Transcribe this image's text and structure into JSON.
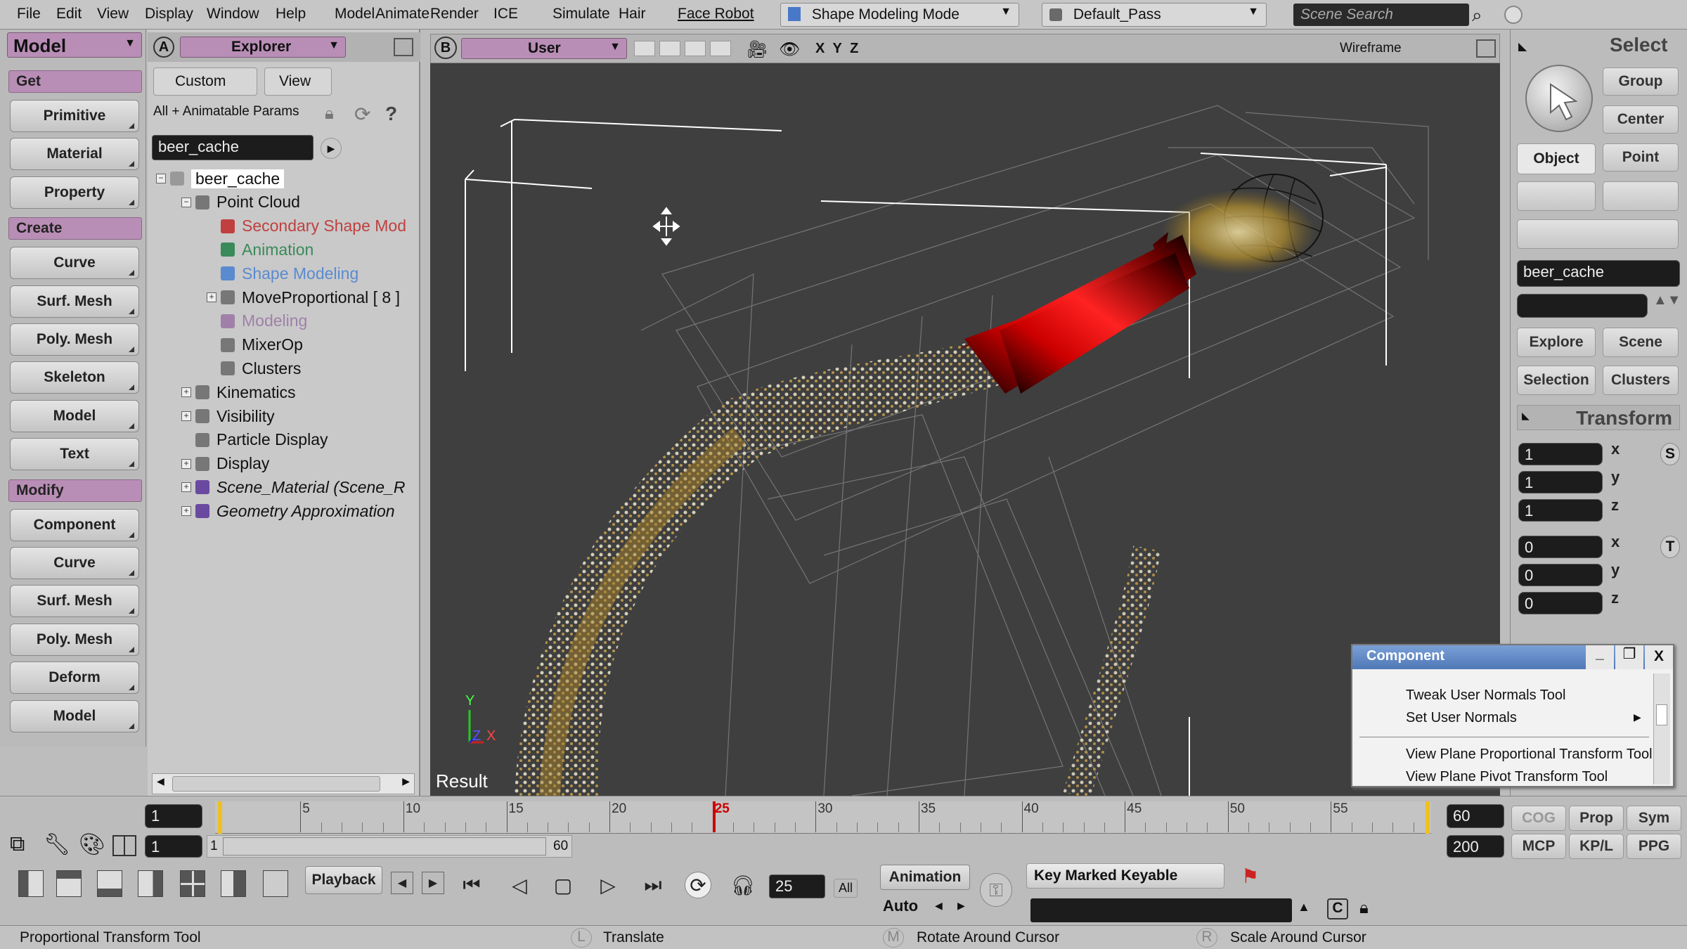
{
  "menu": [
    "File",
    "Edit",
    "View",
    "Display",
    "Window",
    "Help",
    "Model",
    "Animate",
    "Render",
    "ICE",
    "Simulate",
    "Hair",
    "Face Robot"
  ],
  "mode_dropdown": "Shape Modeling Mode",
  "pass_dropdown": "Default_Pass",
  "scene_search_placeholder": "Scene Search",
  "left_panel": {
    "title": "Model",
    "sections": [
      {
        "label": "Get",
        "buttons": [
          "Primitive",
          "Material",
          "Property"
        ]
      },
      {
        "label": "Create",
        "buttons": [
          "Curve",
          "Surf. Mesh",
          "Poly. Mesh",
          "Skeleton",
          "Model",
          "Text"
        ]
      },
      {
        "label": "Modify",
        "buttons": [
          "Component",
          "Curve",
          "Surf. Mesh",
          "Poly. Mesh",
          "Deform",
          "Model"
        ]
      }
    ]
  },
  "explorer": {
    "letter": "A",
    "title": "Explorer",
    "tab_custom": "Custom",
    "tab_view": "View",
    "filter": "All + Animatable Params",
    "search_value": "beer_cache",
    "tree": [
      {
        "label": "beer_cache",
        "indent": 0,
        "toggle": "−",
        "style": "selected"
      },
      {
        "label": "Point Cloud",
        "indent": 1,
        "toggle": "−",
        "style": "normal"
      },
      {
        "label": "Secondary Shape Mod",
        "indent": 2,
        "toggle": "",
        "style": "red"
      },
      {
        "label": "Animation",
        "indent": 2,
        "toggle": "",
        "style": "green"
      },
      {
        "label": "Shape Modeling",
        "indent": 2,
        "toggle": "",
        "style": "blue"
      },
      {
        "label": "MoveProportional [ 8 ]",
        "indent": 2,
        "toggle": "+",
        "style": "normal"
      },
      {
        "label": "Modeling",
        "indent": 2,
        "toggle": "",
        "style": "purple"
      },
      {
        "label": "MixerOp",
        "indent": 2,
        "toggle": "",
        "style": "normal"
      },
      {
        "label": "Clusters",
        "indent": 2,
        "toggle": "",
        "style": "normal"
      },
      {
        "label": "Kinematics",
        "indent": 1,
        "toggle": "+",
        "style": "normal"
      },
      {
        "label": "Visibility",
        "indent": 1,
        "toggle": "+",
        "style": "normal"
      },
      {
        "label": "Particle Display",
        "indent": 1,
        "toggle": "",
        "style": "normal"
      },
      {
        "label": "Display",
        "indent": 1,
        "toggle": "+",
        "style": "normal"
      },
      {
        "label": "Scene_Material (Scene_R",
        "indent": 1,
        "toggle": "+",
        "style": "italic"
      },
      {
        "label": "Geometry Approximation",
        "indent": 1,
        "toggle": "+",
        "style": "italic"
      }
    ]
  },
  "viewport": {
    "letter": "B",
    "camera": "User",
    "axes": "X Y Z",
    "display_mode": "Wireframe",
    "result_label": "Result",
    "gizmo": {
      "y": "Y",
      "z": "Z",
      "x": "X"
    }
  },
  "right_panel": {
    "title": "Select",
    "buttons_top": [
      "Group",
      "Center",
      "Object",
      "Point"
    ],
    "name_field": "beer_cache",
    "buttons_mid": [
      "Explore",
      "Scene",
      "Selection",
      "Clusters"
    ],
    "transform_title": "Transform",
    "scale": [
      "1",
      "1",
      "1"
    ],
    "translate": [
      "0",
      "0",
      "0"
    ],
    "axes": [
      "x",
      "y",
      "z"
    ],
    "scale_letter": "S",
    "translate_letter": "T"
  },
  "component_popup": {
    "title": "Component",
    "items": [
      "Tweak User Normals Tool",
      "Set User Normals",
      "View Plane Proportional Transform Tool",
      "View Plane Pivot Transform Tool"
    ]
  },
  "timeline": {
    "start": "1",
    "end": "60",
    "current_frame": 25,
    "ticks": [
      "5",
      "10",
      "15",
      "20",
      "25",
      "30",
      "35",
      "40",
      "45",
      "50",
      "55"
    ],
    "range_start": "1",
    "range_start2": "1",
    "range_end": "60",
    "range_max": "200"
  },
  "playback": {
    "label": "Playback",
    "frame": "25",
    "all": "All",
    "animation": "Animation",
    "auto": "Auto",
    "key_label": "Key Marked Keyable"
  },
  "bottom_right": [
    "COG",
    "Prop",
    "Sym",
    "MCP",
    "KP/L",
    "PPG"
  ],
  "status": {
    "tool": "Proportional Transform Tool",
    "l_key": "L",
    "l_action": "Translate",
    "m_key": "M",
    "m_action": "Rotate Around Cursor",
    "r_key": "R",
    "r_action": "Scale Around Cursor"
  },
  "colors": {
    "accent_purple": "#b98eb6",
    "viewport_bg": "#3f3f3f",
    "selection_red": "#e01010",
    "timeline_marker": "#cc0000"
  }
}
